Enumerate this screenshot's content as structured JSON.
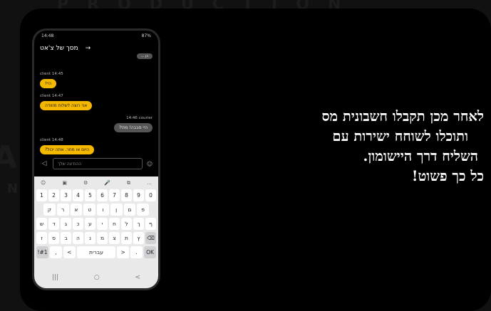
{
  "background": {
    "top_text": "PRODUCTION",
    "letter_a": "A",
    "letter_n": "N"
  },
  "phone": {
    "status": {
      "time": "14:48",
      "right": "87%"
    },
    "appbar": {
      "title": "מסך של צ'אט",
      "back": "→"
    },
    "chat": {
      "messages": [
        {
          "sender_meta": "client 14:45",
          "text": "היי!",
          "side": "left",
          "color": "yellow"
        },
        {
          "sender_meta": "client 14:47",
          "text": "אני רוצה לשלוח מזוודה",
          "side": "left",
          "color": "yellow"
        },
        {
          "sender_meta": "14:46 courier",
          "text": "היי סבבה! מתי?",
          "side": "right",
          "color": "gray"
        },
        {
          "sender_meta": "client 14:48",
          "text": "היום או מחר. אתה יכול?",
          "side": "left",
          "color": "yellow"
        }
      ],
      "top_cut": "כן ..."
    },
    "composer": {
      "placeholder": "ההודעה שלך",
      "send_icon": "◁",
      "emoji_icon": "☺"
    },
    "keyboard": {
      "top": [
        "☺",
        "▣",
        "⚙",
        "🎤",
        "⧉",
        "…"
      ],
      "row1": [
        "1",
        "2",
        "3",
        "4",
        "5",
        "6",
        "7",
        "8",
        "9",
        "0"
      ],
      "row2": [
        "ק",
        "ר",
        "א",
        "ט",
        "ו",
        "ן",
        "ם",
        "פ"
      ],
      "row3": [
        "ש",
        "ד",
        "ג",
        "כ",
        "ע",
        "י",
        "ח",
        "ל",
        "ך",
        "ף"
      ],
      "row4": [
        "ז",
        "ס",
        "ב",
        "ה",
        "נ",
        "מ",
        "צ",
        "ת",
        "ץ",
        "⌫"
      ],
      "row5": [
        "!#1",
        ",",
        "<",
        "עברית",
        ">",
        ".",
        "OK"
      ]
    },
    "nav": [
      "|||",
      "○",
      "<"
    ]
  },
  "headline": {
    "line1": "לאחר מכן תקבלו חשבונית מס",
    "line2": "ותוכלו לשוחח ישירות עם",
    "line3": "השליח דרך היישומון.",
    "line4": "כל כך פשוט!"
  }
}
